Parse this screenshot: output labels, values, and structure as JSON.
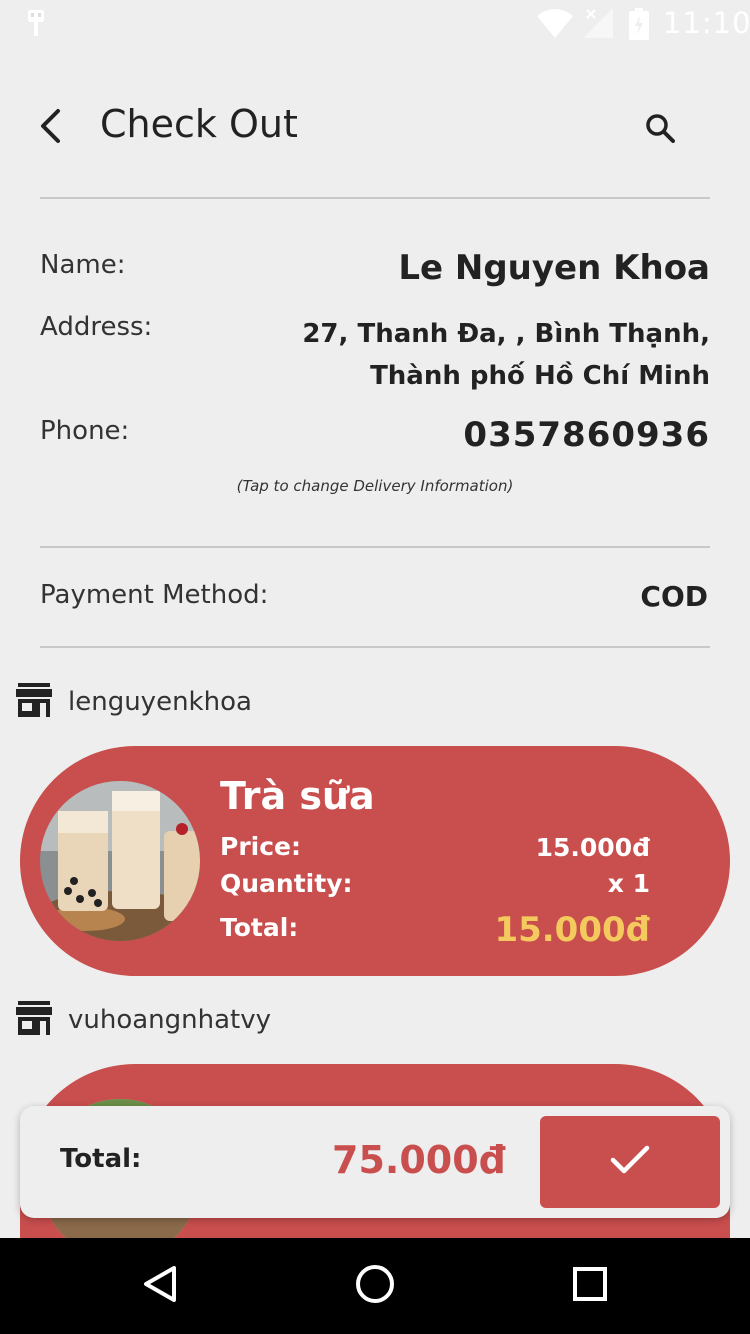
{
  "status_bar": {
    "time": "11:10"
  },
  "header": {
    "title": "Check Out"
  },
  "delivery": {
    "name_label": "Name:",
    "name_value": "Le Nguyen Khoa",
    "address_label": "Address:",
    "address_line1": "27, Thanh Đa, , Bình Thạnh,",
    "address_line2": "Thành phố Hồ Chí Minh",
    "phone_label": "Phone:",
    "phone_value": "0357860936",
    "hint": "(Tap to change Delivery Information)"
  },
  "payment": {
    "label": "Payment Method:",
    "value": "COD"
  },
  "orders": [
    {
      "shop": "lenguyenkhoa",
      "item_name": "Trà sữa",
      "price_label": "Price:",
      "price": "15.000đ",
      "quantity_label": "Quantity:",
      "quantity": "x 1",
      "total_label": "Total:",
      "total": "15.000đ"
    },
    {
      "shop": "vuhoangnhatvy"
    }
  ],
  "checkout": {
    "total_label": "Total:",
    "total_value": "75.000đ"
  },
  "colors": {
    "accent": "#c94e4e",
    "highlight": "#f4c95d",
    "background": "#eeeeee"
  },
  "icons": {
    "back": "arrow-back-icon",
    "search": "search-icon",
    "shop": "store-icon",
    "confirm": "check-icon"
  }
}
